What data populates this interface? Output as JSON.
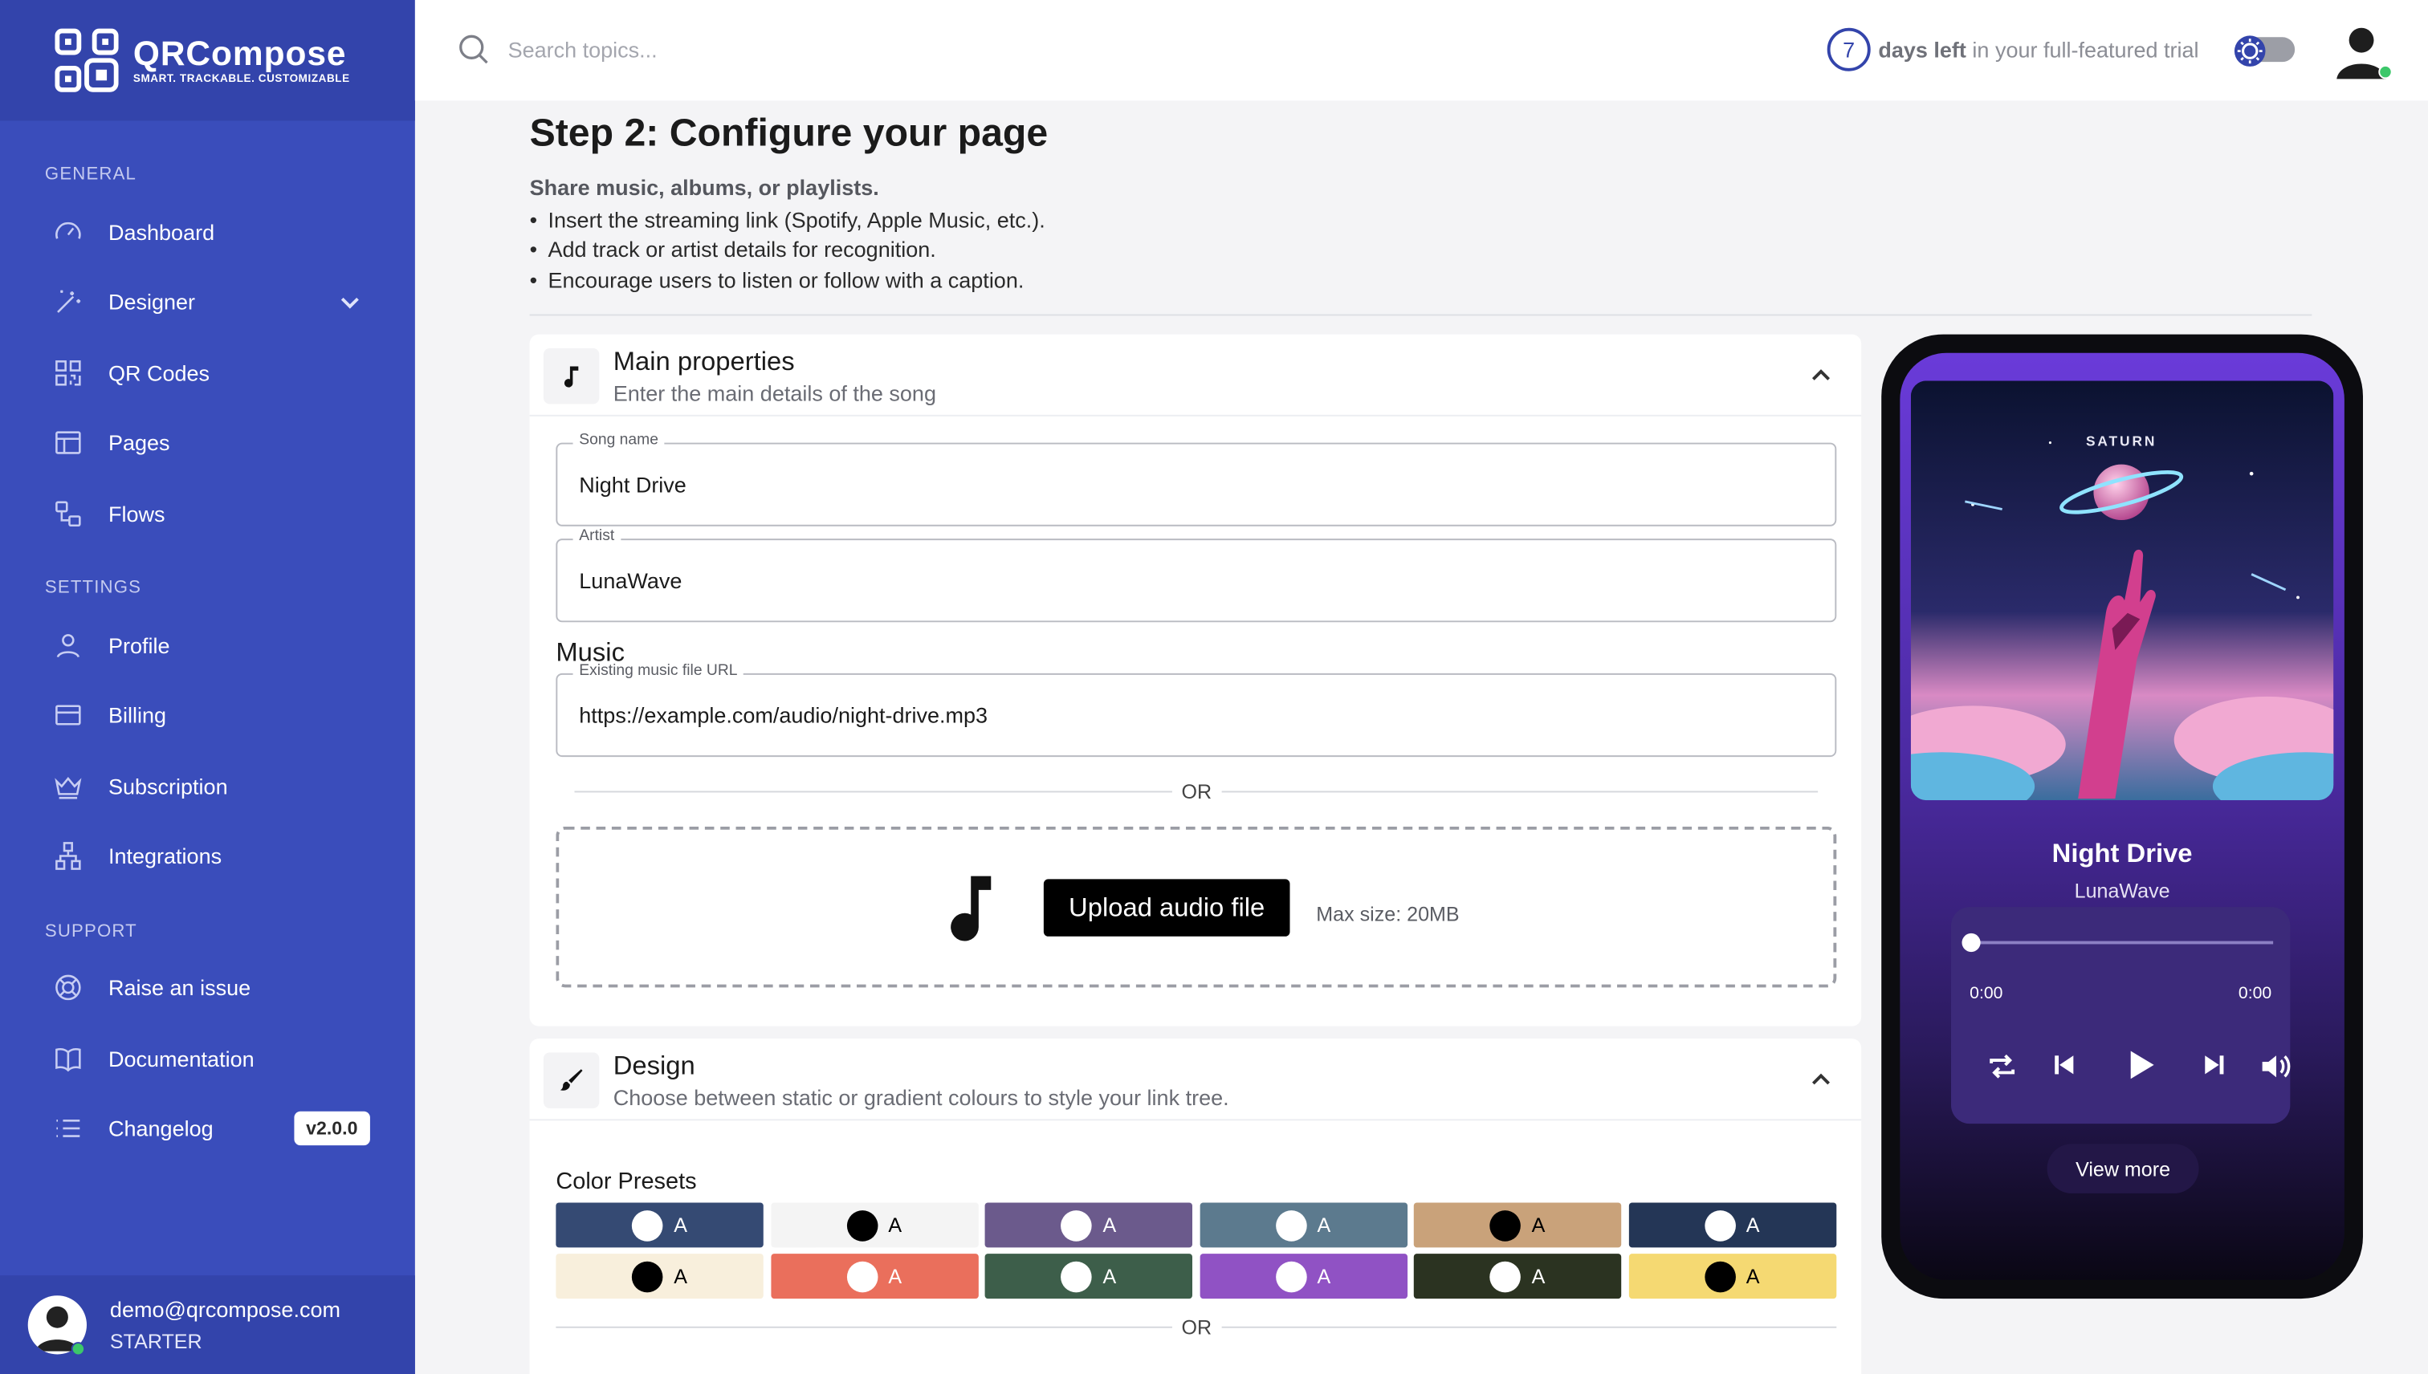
{
  "brand": {
    "name": "QRCompose",
    "tagline": "SMART. TRACKABLE. CUSTOMIZABLE"
  },
  "sidebar": {
    "sections": [
      {
        "label": "GENERAL"
      },
      {
        "label": "SETTINGS"
      },
      {
        "label": "SUPPORT"
      }
    ],
    "items": [
      {
        "label": "Dashboard",
        "icon": "gauge-icon"
      },
      {
        "label": "Designer",
        "icon": "magic-wand-icon"
      },
      {
        "label": "QR Codes",
        "icon": "qr-code-icon"
      },
      {
        "label": "Pages",
        "icon": "layout-icon"
      },
      {
        "label": "Flows",
        "icon": "flow-icon"
      },
      {
        "label": "Profile",
        "icon": "user-icon"
      },
      {
        "label": "Billing",
        "icon": "credit-card-icon"
      },
      {
        "label": "Subscription",
        "icon": "crown-icon"
      },
      {
        "label": "Integrations",
        "icon": "integrations-icon"
      },
      {
        "label": "Raise an issue",
        "icon": "lifebuoy-icon"
      },
      {
        "label": "Documentation",
        "icon": "book-icon"
      },
      {
        "label": "Changelog",
        "icon": "list-icon",
        "badge": "v2.0.0"
      }
    ],
    "user": {
      "email": "demo@qrcompose.com",
      "plan": "STARTER"
    }
  },
  "topbar": {
    "search_placeholder": "Search topics...",
    "trial_days": "7",
    "trial_bold": "days left",
    "trial_rest": " in your full-featured trial"
  },
  "page": {
    "title": "Step 2: Configure your page",
    "subtitle": "Share music, albums, or playlists.",
    "bullets": [
      "Insert the streaming link (Spotify, Apple Music, etc.).",
      "Add track or artist details for recognition.",
      "Encourage users to listen or follow with a caption."
    ]
  },
  "main_properties": {
    "title": "Main properties",
    "subtitle": "Enter the main details of the song",
    "song_name_label": "Song name",
    "song_name": "Night Drive",
    "artist_label": "Artist",
    "artist": "LunaWave",
    "music_label": "Music",
    "url_label": "Existing music file URL",
    "url": "https://example.com/audio/night-drive.mp3",
    "or": "OR",
    "upload_button": "Upload audio file",
    "max_size": "Max size: 20MB"
  },
  "design": {
    "title": "Design",
    "subtitle": "Choose between static or gradient colours to style your link tree.",
    "presets_label": "Color Presets",
    "or": "OR",
    "presets": [
      {
        "bg": "#354a73",
        "dot": "#ffffff",
        "text": "#ffffff",
        "label": "A"
      },
      {
        "bg": "#f4f4f4",
        "dot": "#000000",
        "text": "#000000",
        "label": "A"
      },
      {
        "bg": "#6b5a8c",
        "dot": "#ffffff",
        "text": "#ffffff",
        "label": "A"
      },
      {
        "bg": "#5c7a8e",
        "dot": "#ffffff",
        "text": "#ffffff",
        "label": "A"
      },
      {
        "bg": "#c9a27a",
        "dot": "#000000",
        "text": "#000000",
        "label": "A"
      },
      {
        "bg": "#243656",
        "dot": "#ffffff",
        "text": "#ffffff",
        "label": "A"
      },
      {
        "bg": "#f8efdc",
        "dot": "#000000",
        "text": "#000000",
        "label": "A"
      },
      {
        "bg": "#ea6f5c",
        "dot": "#ffffff",
        "text": "#ffffff",
        "label": "A"
      },
      {
        "bg": "#3d5e4a",
        "dot": "#ffffff",
        "text": "#ffffff",
        "label": "A"
      },
      {
        "bg": "#9052c4",
        "dot": "#ffffff",
        "text": "#ffffff",
        "label": "A"
      },
      {
        "bg": "#2b3321",
        "dot": "#ffffff",
        "text": "#ffffff",
        "label": "A"
      },
      {
        "bg": "#f5d972",
        "dot": "#000000",
        "text": "#000000",
        "label": "A"
      }
    ]
  },
  "preview": {
    "album_text": "SATURN",
    "song_title": "Night Drive",
    "artist": "LunaWave",
    "time_current": "0:00",
    "time_total": "0:00",
    "progress": 0,
    "view_more": "View more"
  },
  "colors": {
    "sidebar": "#3a4dbb",
    "sidebar_dark": "#3344ab",
    "accent": "#3344ab",
    "online": "#3cc76a"
  }
}
